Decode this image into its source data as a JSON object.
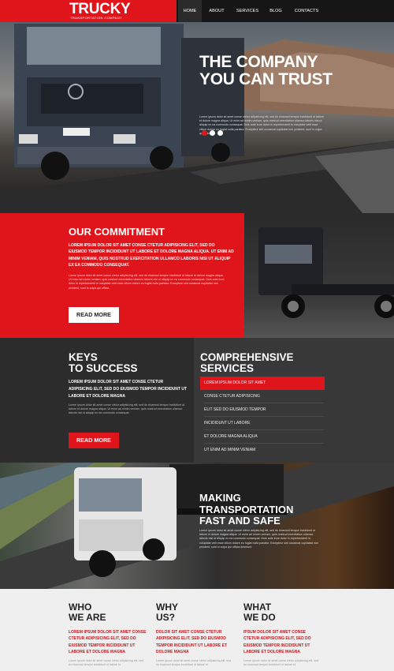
{
  "header": {
    "logo": "TRUCKY",
    "tagline": "TRANSPORTATION COMPANY",
    "nav": [
      "HOME",
      "ABOUT",
      "SERVICES",
      "BLOG",
      "CONTACTS"
    ]
  },
  "hero": {
    "title_line1": "THE COMPANY",
    "title_line2": "YOU CAN TRUST",
    "body": "Lorem ipsum dolor sit amet conse ctetur adipisicing elit, sed do eiusmod tempor incididunt ut labore et dolore magna aliqua. Ut enim ad minim veniam, quis nostrud exercitation ullamco laboris nisi ut aliquip ex ea commodo consequat. Duis aute irure dolor in reprehenderit in voluptate velit esse cillum dolore eu fugiat nulla pariatur. Excepteur sint occaecat cupidatat non proident, sunt in culpa qui officia."
  },
  "commitment": {
    "title": "OUR COMMITMENT",
    "lead": "LOREM IPSUM DOLOR SIT AMET CONSE CTETUR ADIPISICING ELIT, SED DO EIUSMOD TEMPOR INCIDIDUNT UT LABORE ET DOLORE MAGNA ALIQUA. UT ENIM AD MINIM VENIAM, QUIS NOSTRUD EXERCITATION ULLAMCO LABORIS NISI UT ALIQUIP EX EA COMMODO CONSEQUAT.",
    "body": "Lorem ipsum dolor sit amet conse ctetur adipisicing elit, sed do eiusmod tempor incididunt ut labore et dolore magna aliqua. Ut enim ad minim veniam, quis nostrud exercitation ullamco laboris nisi ut aliquip ex ea commodo consequat. Duis aute irure dolor in reprehenderit in voluptate velit esse cillum dolore eu fugiat nulla pariatur. Excepteur sint occaecat cupidatat non proident, sunt in culpa qui officia.",
    "button": "READ MORE"
  },
  "keys": {
    "title_line1": "KEYS",
    "title_line2": "TO SUCCESS",
    "lead": "LOREM IPSUM DOLOR SIT AMET CONSE CTETUR ADIPISICING ELIT, SED DO EIUSMOD TEMPOR INCIDIDUNT UT LABORE ET DOLORE MAGNA",
    "body": "Lorem ipsum dolor sit amet conse ctetur adipisicing elit, sed do eiusmod tempor incididunt ut labore et dolore magna aliqua. Ut enim ad minim veniam, quis nostrud exercitation ullamco laboris nisi ut aliquip ex ea commodo consequat.",
    "button": "READ MORE"
  },
  "services": {
    "title_line1": "COMPREHENSIVE",
    "title_line2": "SERVICES",
    "items": [
      "LOREM IPSUM DOLOR SIT AMET",
      "CONSE CTETUR ADIPISICING",
      "ELIT SED DO EIUSMOD TEMPOR",
      "INCIDIDUNT UT LABORE",
      "ET DOLORE MAGNA ALIQUA",
      "UT ENIM AD MINIM VENIAM"
    ]
  },
  "making": {
    "title_line1": "MAKING",
    "title_line2": "TRANSPORTATION",
    "title_line3": "FAST AND SAFE",
    "body": "Lorem ipsum dolor sit amet conse ctetur adipisicing elit, sed do eiusmod tempor incididunt ut labore et dolore magna aliqua. Ut enim ad minim veniam, quis nostrud exercitation ullamco laboris nisi ut aliquip ex ea commodo consequat. Duis aute irure dolor in reprehenderit in voluptate velit esse cillum dolore eu fugiat nulla pariatur. Excepteur sint occaecat cupidatat non proident, sunt in culpa qui officia deserunt."
  },
  "bottom": {
    "cols": [
      {
        "t1": "WHO",
        "t2": "WE ARE",
        "red": "LOREM IPSUM DOLOR SIT AMET CONSE CTETUR ADIPISICING ELIT, SED DO EIUSMOD TEMPOR INCIDIDUNT UT LABORE ET DOLORE MAGNA",
        "body": "Lorem ipsum dolor sit amet conse ctetur adipisicing elit, sed do eiusmod tempor incididunt ut labore et"
      },
      {
        "t1": "WHY",
        "t2": "US?",
        "red": "DOLOR SIT AMET CONSE CTETUR ADIPISICING ELIT, SED DO EIUSMOD TEMPOR INCIDIDUNT UT LABORE ET DOLORE MAGNA",
        "body": "Lorem ipsum dolor sit amet conse ctetur adipisicing elit, sed do eiusmod tempor incididunt ut labore et"
      },
      {
        "t1": "WHAT",
        "t2": "WE DO",
        "red": "IPSUM DOLOR SIT AMET CONSE CTETUR ADIPISICING ELIT, SED DO EIUSMOD TEMPOR INCIDIDUNT UT LABORE ET DOLORE MAGNA",
        "body": "Lorem ipsum dolor sit amet conse ctetur adipisicing elit, sed do eiusmod tempor incididunt ut labore et"
      }
    ]
  },
  "colors": {
    "brand_red": "#e0141b",
    "dark": "#161616",
    "panel": "#2c2c2c",
    "panel_alt": "#383838"
  },
  "icons": [
    "truck-image",
    "slider-dot"
  ]
}
